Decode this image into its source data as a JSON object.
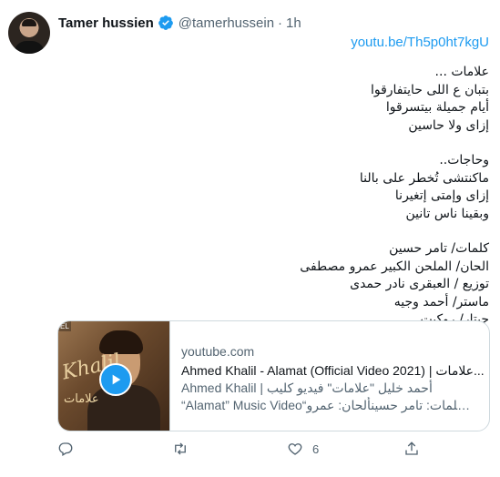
{
  "tweet": {
    "author_name": "Tamer hussien",
    "handle": "@tamerhussein",
    "separator": "·",
    "time": "1h",
    "link": "youtu.be/Th5p0ht7kgU",
    "stanza1": [
      "علامات ...",
      "بتبان ع اللى حايتفارقوا",
      "أيام جميلة بيتسرقوا",
      "إزاى ولا حاسين"
    ],
    "stanza2": [
      "وحاجات..",
      "ماكنتشى تُخطر على بالنا",
      "إزاى وإمتى إتغيرنا",
      "وبقينا ناس تانين"
    ],
    "credits": [
      "كلمات/ تامر حسين",
      "الحان/ الملحن الكبير عمرو مصطفى",
      "توزيع / العبقرى نادر حمدى",
      "ماستر/ أحمد وجيه",
      "جيتار/ روكيت"
    ]
  },
  "card": {
    "domain": "youtube.com",
    "title": "Ahmed Khalil - Alamat (Official Video 2021) | علامات...",
    "desc1": "أحمد خليل \"علامات\" فيديو كليب | Ahmed Khalil",
    "desc2": "“Alamat” Music Video“كلمات: تامر حسينألحان: عمرو ...",
    "thumb_text": "Khalil",
    "thumb_text_ar": "علامات",
    "thumb_badge": "EL"
  },
  "actions": {
    "reply_count": "",
    "retweet_count": "",
    "like_count": "6",
    "share_count": ""
  },
  "colors": {
    "accent": "#1d9bf0",
    "muted": "#536471",
    "text": "#0f1419"
  }
}
